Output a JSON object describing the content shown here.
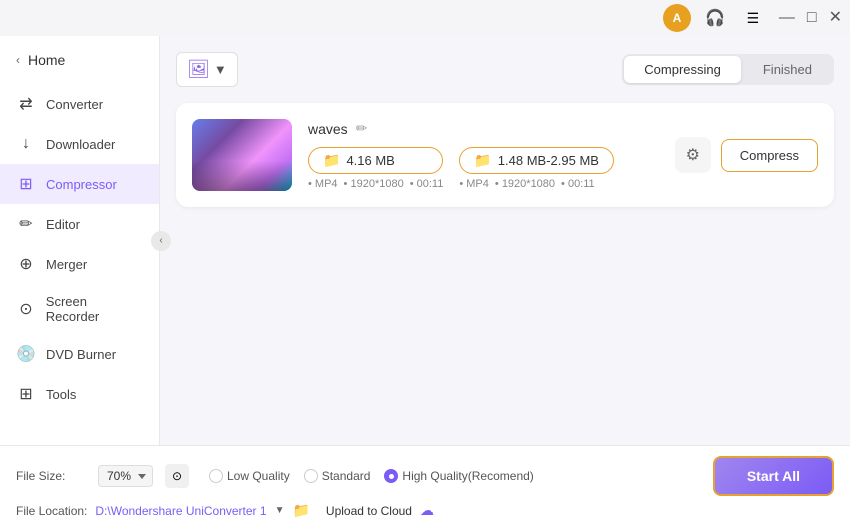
{
  "titlebar": {
    "avatar_label": "A",
    "minimize": "—",
    "maximize": "□",
    "close": "✕"
  },
  "sidebar": {
    "home_label": "Home",
    "items": [
      {
        "id": "converter",
        "label": "Converter",
        "icon": "⇄"
      },
      {
        "id": "downloader",
        "label": "Downloader",
        "icon": "↓"
      },
      {
        "id": "compressor",
        "label": "Compressor",
        "icon": "⊞",
        "active": true
      },
      {
        "id": "editor",
        "label": "Editor",
        "icon": "✏"
      },
      {
        "id": "merger",
        "label": "Merger",
        "icon": "⊕"
      },
      {
        "id": "screen-recorder",
        "label": "Screen Recorder",
        "icon": "⊙"
      },
      {
        "id": "dvd-burner",
        "label": "DVD Burner",
        "icon": "💿"
      },
      {
        "id": "tools",
        "label": "Tools",
        "icon": "⊞"
      }
    ]
  },
  "toolbar": {
    "add_button_label": "+",
    "tabs": [
      {
        "id": "compressing",
        "label": "Compressing",
        "active": true
      },
      {
        "id": "finished",
        "label": "Finished",
        "active": false
      }
    ]
  },
  "file": {
    "name": "waves",
    "original_size": "4.16 MB",
    "compressed_size": "1.48 MB-2.95 MB",
    "meta1": "MP4",
    "meta2": "1920*1080",
    "meta3": "00:11",
    "compress_btn_label": "Compress"
  },
  "bottom": {
    "file_size_label": "File Size:",
    "percent": "70%",
    "low_quality": "Low Quality",
    "standard": "Standard",
    "high_quality": "High Quality(Recomend)",
    "file_location_label": "File Location:",
    "location_path": "D:\\Wondershare UniConverter 1",
    "upload_cloud_label": "Upload to Cloud",
    "start_all_label": "Start All"
  }
}
